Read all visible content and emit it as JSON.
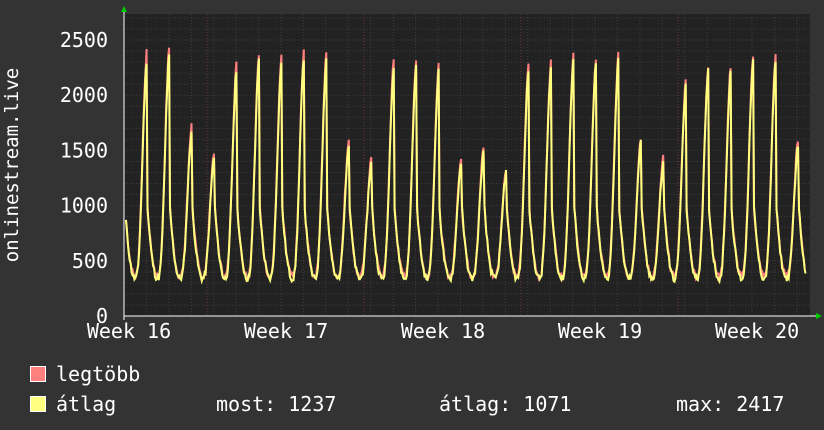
{
  "chart_data": {
    "type": "line",
    "ylabel": "onlinestream.live",
    "ylim": [
      0,
      2500
    ],
    "yticks": [
      0,
      500,
      1000,
      1500,
      2000,
      2500
    ],
    "xticks": [
      "Week 16",
      "Week 17",
      "Week 18",
      "Week 19",
      "Week 20"
    ],
    "grid": true,
    "legend_placement": "bottom-left",
    "series": [
      {
        "name": "legtöbb",
        "color": "#ff7f7f",
        "daily_peaks": [
          2420,
          2460,
          1750,
          1510,
          2310,
          2400,
          2370,
          2420,
          2410,
          1620,
          1450,
          2350,
          2340,
          2290,
          1460,
          1550,
          1360,
          2320,
          2330,
          2400,
          2360,
          2390,
          1640,
          1450,
          2150,
          2300,
          2290,
          2390,
          2380,
          1620
        ]
      },
      {
        "name": "átlag",
        "color": "#ffff7f",
        "daily_peaks": [
          2340,
          2380,
          1690,
          1450,
          2260,
          2350,
          2320,
          2370,
          2360,
          1570,
          1400,
          2300,
          2290,
          2240,
          1410,
          1500,
          1310,
          2270,
          2280,
          2350,
          2310,
          2340,
          1590,
          1400,
          2100,
          2250,
          2240,
          2340,
          2330,
          1570
        ]
      }
    ]
  },
  "legend": {
    "max_label": "legtöbb",
    "avg_label": "átlag"
  },
  "stats": {
    "now": "most: 1237",
    "avg": "átlag: 1071",
    "max": "max: 2417"
  },
  "colors": {
    "background": "#333333",
    "plot_background": "#222222",
    "grid": "#3d3d3d",
    "week_grid": "#6b3a3a",
    "max_series": "#ff7f7f",
    "avg_series": "#ffff7f",
    "axis": "#ffffff",
    "arrow": "#00cc00"
  }
}
